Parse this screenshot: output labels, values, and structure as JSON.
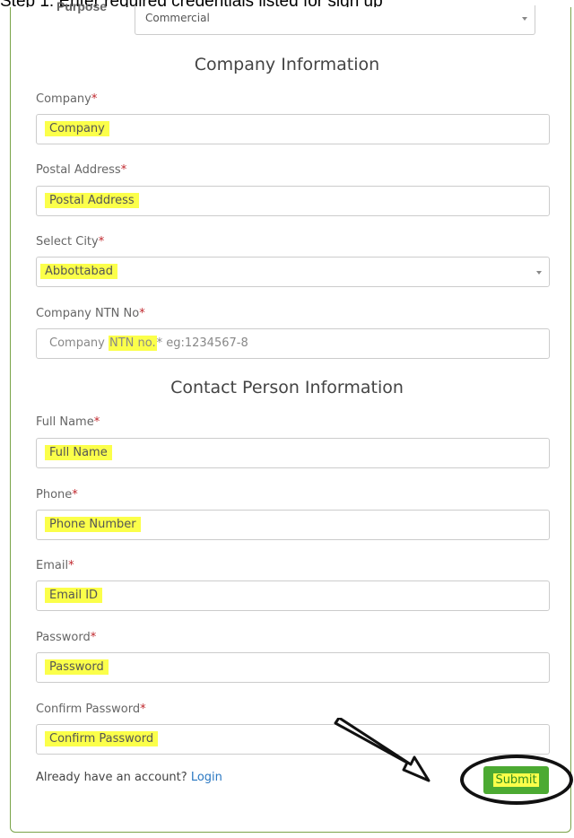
{
  "caption": "Step 1: Enter required credentials listed for sign up",
  "purpose": {
    "label": "Purpose",
    "value": "Commercial"
  },
  "sections": {
    "company": "Company Information",
    "contact": "Contact Person Information"
  },
  "fields": {
    "company": {
      "label": "Company",
      "required": "*",
      "value": "Company"
    },
    "postal": {
      "label": "Postal Address",
      "required": "*",
      "value": "Postal Address"
    },
    "city": {
      "label": "Select City",
      "required": "*",
      "value": "Abbottabad"
    },
    "ntn": {
      "label": "Company NTN No",
      "required": "*",
      "placeholder_prefix": "Company ",
      "placeholder_highlight": "NTN no.",
      "placeholder_suffix": "* eg:1234567-8"
    },
    "fullname": {
      "label": "Full Name",
      "required": "*",
      "value": "Full Name"
    },
    "phone": {
      "label": "Phone",
      "required": "*",
      "value": "Phone Number"
    },
    "email": {
      "label": "Email",
      "required": "*",
      "value": "Email ID"
    },
    "password": {
      "label": "Password",
      "required": "*",
      "value": "Password"
    },
    "confirm": {
      "label": "Confirm Password",
      "required": "*",
      "value": "Confirm Password"
    }
  },
  "footer": {
    "question": "Already have an account?",
    "login_link": "Login",
    "submit_label": "Submit"
  },
  "colors": {
    "highlight": "#fbff4a",
    "submit": "#4caa32",
    "required": "#c0272d",
    "link": "#2a78c2"
  }
}
